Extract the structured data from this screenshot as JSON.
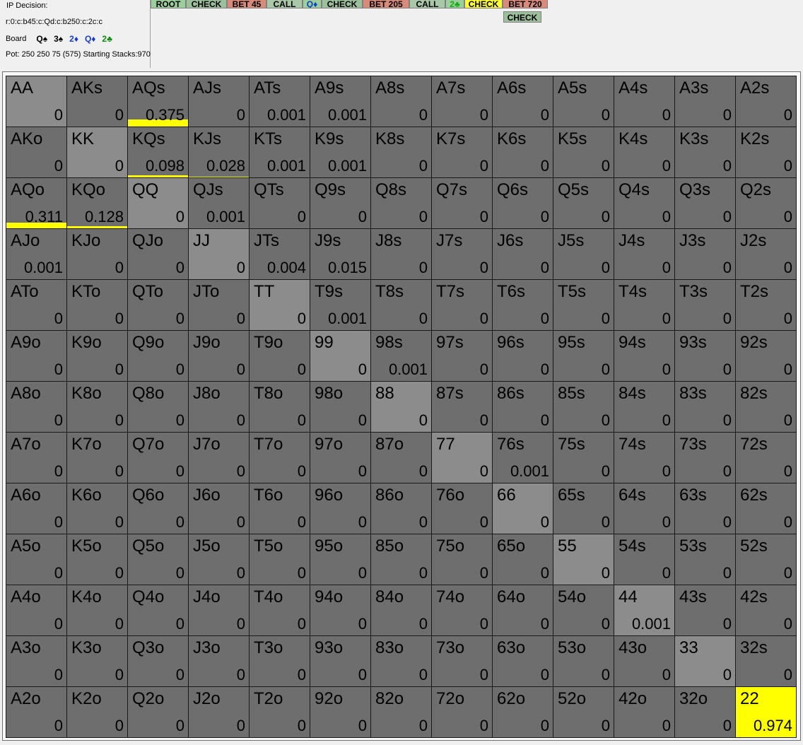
{
  "info": {
    "decision_title": "IP Decision:",
    "line": "r:0:c:b45:c:Qd:c:b250:c:2c:c",
    "board_label": "Board",
    "board_cards": [
      {
        "text": "Q♠",
        "color": "#000000"
      },
      {
        "text": "3♠",
        "color": "#000000"
      },
      {
        "text": "2♦",
        "color": "#1a3ccc"
      },
      {
        "text": "Q♦",
        "color": "#1a3ccc"
      },
      {
        "text": "2♣",
        "color": "#0a8a0a"
      }
    ],
    "pot_line": "Pot: 250 250 75 (575) Starting Stacks:970"
  },
  "actions": [
    {
      "label": "ROOT",
      "kind": "root"
    },
    {
      "label": "CHECK",
      "kind": "check"
    },
    {
      "label": "BET 45",
      "kind": "bet"
    },
    {
      "label": "CALL",
      "kind": "call"
    },
    {
      "label": "Q♦",
      "kind": "card-q"
    },
    {
      "label": "CHECK",
      "kind": "check"
    },
    {
      "label": "BET 205",
      "kind": "bet"
    },
    {
      "label": "CALL",
      "kind": "call"
    },
    {
      "label": "2♣",
      "kind": "card-2"
    },
    {
      "label": "CHECK",
      "kind": "hl"
    },
    {
      "label": "BET 720",
      "kind": "bet"
    },
    {
      "label": "CHECK",
      "kind": "check",
      "row": 2
    }
  ],
  "colors": {
    "cell": "#6e6e6e",
    "pair_cell": "#8c8c8c",
    "highlight": "#ffff00"
  },
  "grid": [
    [
      [
        "AA",
        "0"
      ],
      [
        "AKs",
        "0"
      ],
      [
        "AQs",
        "0.375"
      ],
      [
        "AJs",
        "0"
      ],
      [
        "ATs",
        "0.001"
      ],
      [
        "A9s",
        "0.001"
      ],
      [
        "A8s",
        "0"
      ],
      [
        "A7s",
        "0"
      ],
      [
        "A6s",
        "0"
      ],
      [
        "A5s",
        "0"
      ],
      [
        "A4s",
        "0"
      ],
      [
        "A3s",
        "0"
      ],
      [
        "A2s",
        "0"
      ]
    ],
    [
      [
        "AKo",
        "0"
      ],
      [
        "KK",
        "0"
      ],
      [
        "KQs",
        "0.098"
      ],
      [
        "KJs",
        "0.028"
      ],
      [
        "KTs",
        "0.001"
      ],
      [
        "K9s",
        "0.001"
      ],
      [
        "K8s",
        "0"
      ],
      [
        "K7s",
        "0"
      ],
      [
        "K6s",
        "0"
      ],
      [
        "K5s",
        "0"
      ],
      [
        "K4s",
        "0"
      ],
      [
        "K3s",
        "0"
      ],
      [
        "K2s",
        "0"
      ]
    ],
    [
      [
        "AQo",
        "0.311"
      ],
      [
        "KQo",
        "0.128"
      ],
      [
        "QQ",
        "0"
      ],
      [
        "QJs",
        "0.001"
      ],
      [
        "QTs",
        "0"
      ],
      [
        "Q9s",
        "0"
      ],
      [
        "Q8s",
        "0"
      ],
      [
        "Q7s",
        "0"
      ],
      [
        "Q6s",
        "0"
      ],
      [
        "Q5s",
        "0"
      ],
      [
        "Q4s",
        "0"
      ],
      [
        "Q3s",
        "0"
      ],
      [
        "Q2s",
        "0"
      ]
    ],
    [
      [
        "AJo",
        "0.001"
      ],
      [
        "KJo",
        "0"
      ],
      [
        "QJo",
        "0"
      ],
      [
        "JJ",
        "0"
      ],
      [
        "JTs",
        "0.004"
      ],
      [
        "J9s",
        "0.015"
      ],
      [
        "J8s",
        "0"
      ],
      [
        "J7s",
        "0"
      ],
      [
        "J6s",
        "0"
      ],
      [
        "J5s",
        "0"
      ],
      [
        "J4s",
        "0"
      ],
      [
        "J3s",
        "0"
      ],
      [
        "J2s",
        "0"
      ]
    ],
    [
      [
        "ATo",
        "0"
      ],
      [
        "KTo",
        "0"
      ],
      [
        "QTo",
        "0"
      ],
      [
        "JTo",
        "0"
      ],
      [
        "TT",
        "0"
      ],
      [
        "T9s",
        "0.001"
      ],
      [
        "T8s",
        "0"
      ],
      [
        "T7s",
        "0"
      ],
      [
        "T6s",
        "0"
      ],
      [
        "T5s",
        "0"
      ],
      [
        "T4s",
        "0"
      ],
      [
        "T3s",
        "0"
      ],
      [
        "T2s",
        "0"
      ]
    ],
    [
      [
        "A9o",
        "0"
      ],
      [
        "K9o",
        "0"
      ],
      [
        "Q9o",
        "0"
      ],
      [
        "J9o",
        "0"
      ],
      [
        "T9o",
        "0"
      ],
      [
        "99",
        "0"
      ],
      [
        "98s",
        "0.001"
      ],
      [
        "97s",
        "0"
      ],
      [
        "96s",
        "0"
      ],
      [
        "95s",
        "0"
      ],
      [
        "94s",
        "0"
      ],
      [
        "93s",
        "0"
      ],
      [
        "92s",
        "0"
      ]
    ],
    [
      [
        "A8o",
        "0"
      ],
      [
        "K8o",
        "0"
      ],
      [
        "Q8o",
        "0"
      ],
      [
        "J8o",
        "0"
      ],
      [
        "T8o",
        "0"
      ],
      [
        "98o",
        "0"
      ],
      [
        "88",
        "0"
      ],
      [
        "87s",
        "0"
      ],
      [
        "86s",
        "0"
      ],
      [
        "85s",
        "0"
      ],
      [
        "84s",
        "0"
      ],
      [
        "83s",
        "0"
      ],
      [
        "82s",
        "0"
      ]
    ],
    [
      [
        "A7o",
        "0"
      ],
      [
        "K7o",
        "0"
      ],
      [
        "Q7o",
        "0"
      ],
      [
        "J7o",
        "0"
      ],
      [
        "T7o",
        "0"
      ],
      [
        "97o",
        "0"
      ],
      [
        "87o",
        "0"
      ],
      [
        "77",
        "0"
      ],
      [
        "76s",
        "0.001"
      ],
      [
        "75s",
        "0"
      ],
      [
        "74s",
        "0"
      ],
      [
        "73s",
        "0"
      ],
      [
        "72s",
        "0"
      ]
    ],
    [
      [
        "A6o",
        "0"
      ],
      [
        "K6o",
        "0"
      ],
      [
        "Q6o",
        "0"
      ],
      [
        "J6o",
        "0"
      ],
      [
        "T6o",
        "0"
      ],
      [
        "96o",
        "0"
      ],
      [
        "86o",
        "0"
      ],
      [
        "76o",
        "0"
      ],
      [
        "66",
        "0"
      ],
      [
        "65s",
        "0"
      ],
      [
        "64s",
        "0"
      ],
      [
        "63s",
        "0"
      ],
      [
        "62s",
        "0"
      ]
    ],
    [
      [
        "A5o",
        "0"
      ],
      [
        "K5o",
        "0"
      ],
      [
        "Q5o",
        "0"
      ],
      [
        "J5o",
        "0"
      ],
      [
        "T5o",
        "0"
      ],
      [
        "95o",
        "0"
      ],
      [
        "85o",
        "0"
      ],
      [
        "75o",
        "0"
      ],
      [
        "65o",
        "0"
      ],
      [
        "55",
        "0"
      ],
      [
        "54s",
        "0"
      ],
      [
        "53s",
        "0"
      ],
      [
        "52s",
        "0"
      ]
    ],
    [
      [
        "A4o",
        "0"
      ],
      [
        "K4o",
        "0"
      ],
      [
        "Q4o",
        "0"
      ],
      [
        "J4o",
        "0"
      ],
      [
        "T4o",
        "0"
      ],
      [
        "94o",
        "0"
      ],
      [
        "84o",
        "0"
      ],
      [
        "74o",
        "0"
      ],
      [
        "64o",
        "0"
      ],
      [
        "54o",
        "0"
      ],
      [
        "44",
        "0.001"
      ],
      [
        "43s",
        "0"
      ],
      [
        "42s",
        "0"
      ]
    ],
    [
      [
        "A3o",
        "0"
      ],
      [
        "K3o",
        "0"
      ],
      [
        "Q3o",
        "0"
      ],
      [
        "J3o",
        "0"
      ],
      [
        "T3o",
        "0"
      ],
      [
        "93o",
        "0"
      ],
      [
        "83o",
        "0"
      ],
      [
        "73o",
        "0"
      ],
      [
        "63o",
        "0"
      ],
      [
        "53o",
        "0"
      ],
      [
        "43o",
        "0"
      ],
      [
        "33",
        "0"
      ],
      [
        "32s",
        "0"
      ]
    ],
    [
      [
        "A2o",
        "0"
      ],
      [
        "K2o",
        "0"
      ],
      [
        "Q2o",
        "0"
      ],
      [
        "J2o",
        "0"
      ],
      [
        "T2o",
        "0"
      ],
      [
        "92o",
        "0"
      ],
      [
        "82o",
        "0"
      ],
      [
        "72o",
        "0"
      ],
      [
        "62o",
        "0"
      ],
      [
        "52o",
        "0"
      ],
      [
        "42o",
        "0"
      ],
      [
        "32o",
        "0"
      ],
      [
        "22",
        "0.974"
      ]
    ]
  ]
}
